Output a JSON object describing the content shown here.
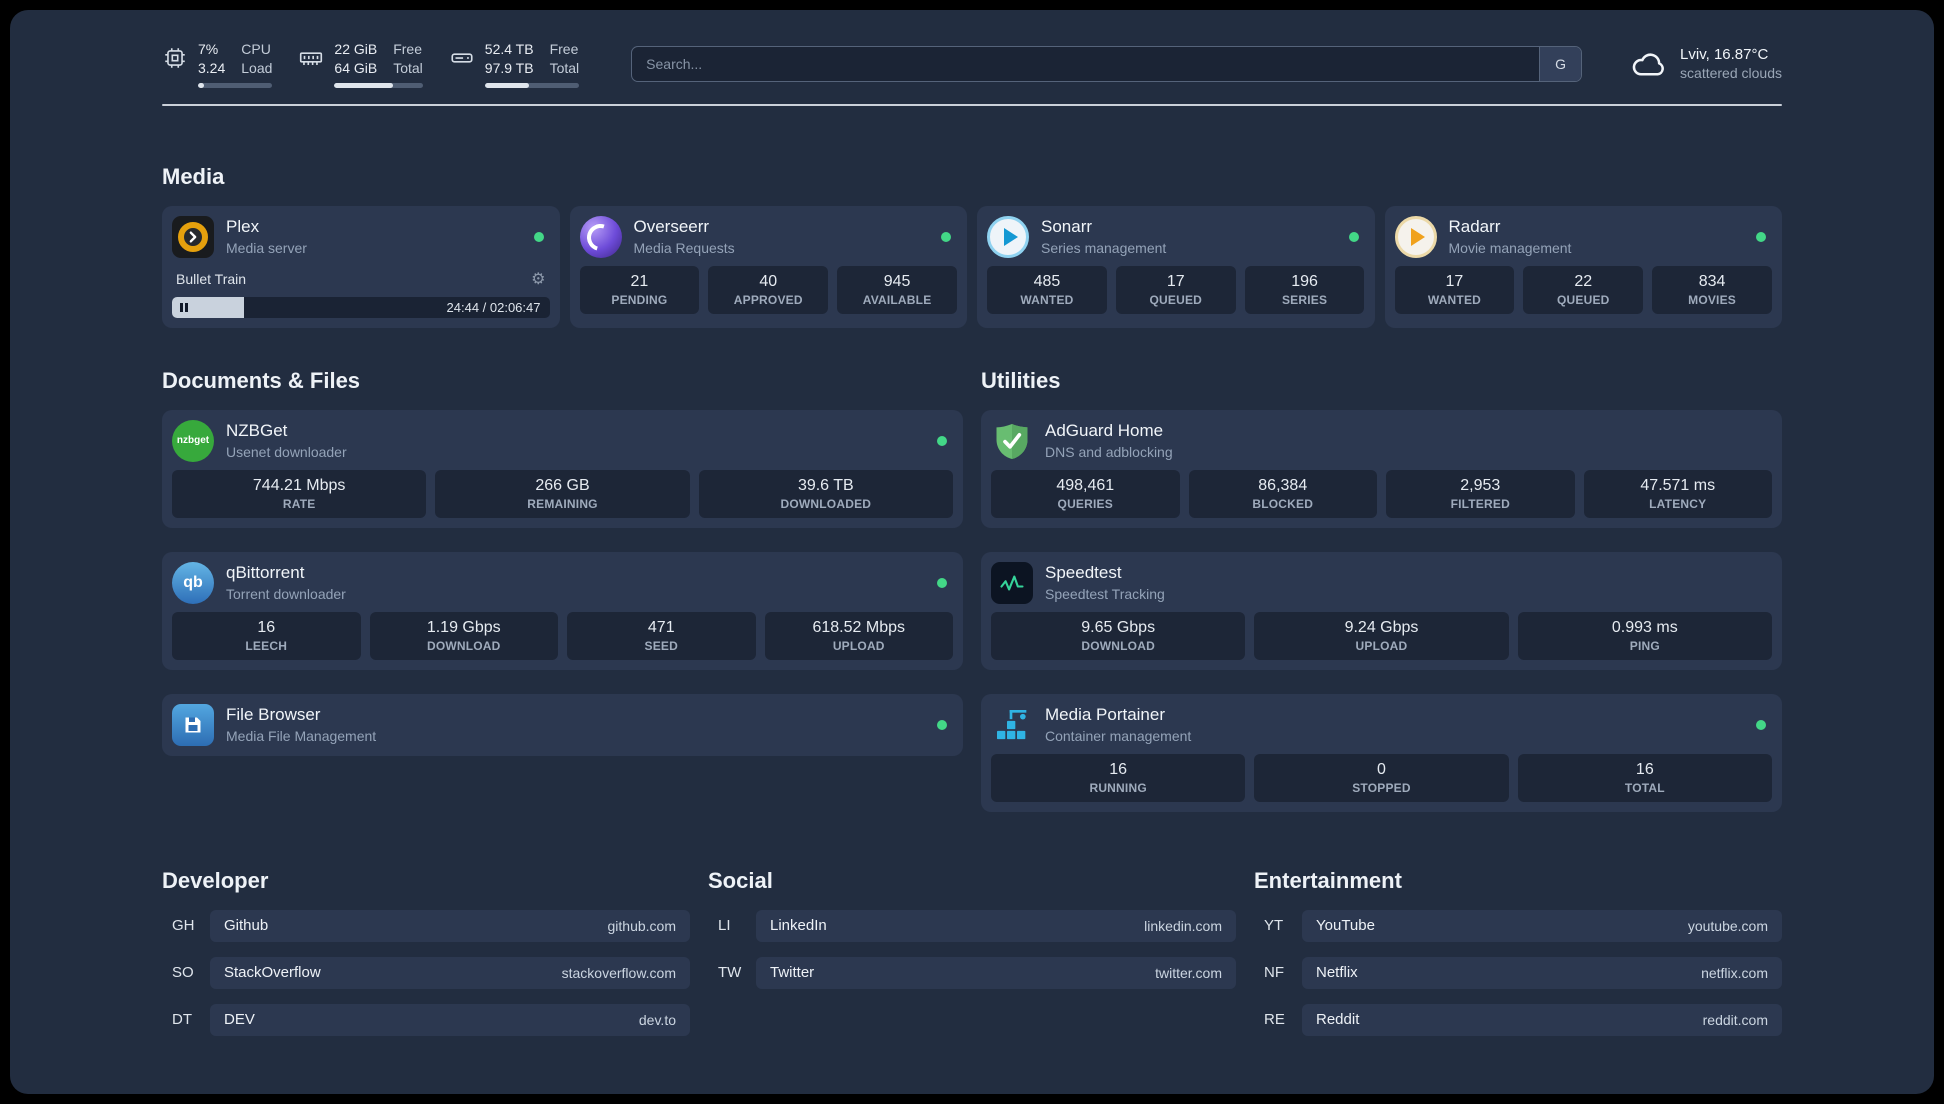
{
  "topbar": {
    "cpu": {
      "values": [
        "7%",
        "3.24"
      ],
      "labels": [
        "CPU",
        "Load"
      ],
      "progress_pct": 8
    },
    "memory": {
      "values": [
        "22 GiB",
        "64 GiB"
      ],
      "labels": [
        "Free",
        "Total"
      ],
      "progress_pct": 66
    },
    "disk": {
      "values": [
        "52.4 TB",
        "97.9 TB"
      ],
      "labels": [
        "Free",
        "Total"
      ],
      "progress_pct": 47
    },
    "search": {
      "placeholder": "Search...",
      "provider_button": "G"
    },
    "weather": {
      "location": "Lviv, 16.87°C",
      "condition": "scattered clouds"
    }
  },
  "icons": {
    "gear": "⚙"
  },
  "sections": {
    "media": {
      "title": "Media",
      "plex": {
        "name": "Plex",
        "description": "Media server",
        "player": {
          "track_title": "Bullet Train",
          "time": "24:44 / 02:06:47",
          "progress_pct": 19
        }
      },
      "overseerr": {
        "name": "Overseerr",
        "description": "Media Requests",
        "stats": [
          {
            "value": "21",
            "label": "PENDING"
          },
          {
            "value": "40",
            "label": "APPROVED"
          },
          {
            "value": "945",
            "label": "AVAILABLE"
          }
        ]
      },
      "sonarr": {
        "name": "Sonarr",
        "description": "Series management",
        "stats": [
          {
            "value": "485",
            "label": "WANTED"
          },
          {
            "value": "17",
            "label": "QUEUED"
          },
          {
            "value": "196",
            "label": "SERIES"
          }
        ]
      },
      "radarr": {
        "name": "Radarr",
        "description": "Movie management",
        "stats": [
          {
            "value": "17",
            "label": "WANTED"
          },
          {
            "value": "22",
            "label": "QUEUED"
          },
          {
            "value": "834",
            "label": "MOVIES"
          }
        ]
      }
    },
    "documents": {
      "title": "Documents & Files",
      "nzbget": {
        "name": "NZBGet",
        "description": "Usenet downloader",
        "icon_text": "nzbget",
        "stats": [
          {
            "value": "744.21 Mbps",
            "label": "RATE"
          },
          {
            "value": "266 GB",
            "label": "REMAINING"
          },
          {
            "value": "39.6 TB",
            "label": "DOWNLOADED"
          }
        ]
      },
      "qbittorrent": {
        "name": "qBittorrent",
        "description": "Torrent downloader",
        "icon_text": "qb",
        "stats": [
          {
            "value": "16",
            "label": "LEECH"
          },
          {
            "value": "1.19 Gbps",
            "label": "DOWNLOAD"
          },
          {
            "value": "471",
            "label": "SEED"
          },
          {
            "value": "618.52 Mbps",
            "label": "UPLOAD"
          }
        ]
      },
      "filebrowser": {
        "name": "File Browser",
        "description": "Media File Management"
      }
    },
    "utilities": {
      "title": "Utilities",
      "adguard": {
        "name": "AdGuard Home",
        "description": "DNS and adblocking",
        "stats": [
          {
            "value": "498,461",
            "label": "QUERIES"
          },
          {
            "value": "86,384",
            "label": "BLOCKED"
          },
          {
            "value": "2,953",
            "label": "FILTERED"
          },
          {
            "value": "47.571 ms",
            "label": "LATENCY"
          }
        ]
      },
      "speedtest": {
        "name": "Speedtest",
        "description": "Speedtest Tracking",
        "stats": [
          {
            "value": "9.65 Gbps",
            "label": "DOWNLOAD"
          },
          {
            "value": "9.24 Gbps",
            "label": "UPLOAD"
          },
          {
            "value": "0.993 ms",
            "label": "PING"
          }
        ]
      },
      "portainer": {
        "name": "Media Portainer",
        "description": "Container management",
        "stats": [
          {
            "value": "16",
            "label": "RUNNING"
          },
          {
            "value": "0",
            "label": "STOPPED"
          },
          {
            "value": "16",
            "label": "TOTAL"
          }
        ]
      }
    },
    "developer": {
      "title": "Developer",
      "links": [
        {
          "abbr": "GH",
          "name": "Github",
          "url": "github.com"
        },
        {
          "abbr": "SO",
          "name": "StackOverflow",
          "url": "stackoverflow.com"
        },
        {
          "abbr": "DT",
          "name": "DEV",
          "url": "dev.to"
        }
      ]
    },
    "social": {
      "title": "Social",
      "links": [
        {
          "abbr": "LI",
          "name": "LinkedIn",
          "url": "linkedin.com"
        },
        {
          "abbr": "TW",
          "name": "Twitter",
          "url": "twitter.com"
        }
      ]
    },
    "entertainment": {
      "title": "Entertainment",
      "links": [
        {
          "abbr": "YT",
          "name": "YouTube",
          "url": "youtube.com"
        },
        {
          "abbr": "NF",
          "name": "Netflix",
          "url": "netflix.com"
        },
        {
          "abbr": "RE",
          "name": "Reddit",
          "url": "reddit.com"
        }
      ]
    }
  },
  "colors": {
    "status_online": "#43d787",
    "accent_green": "#35d49a"
  }
}
